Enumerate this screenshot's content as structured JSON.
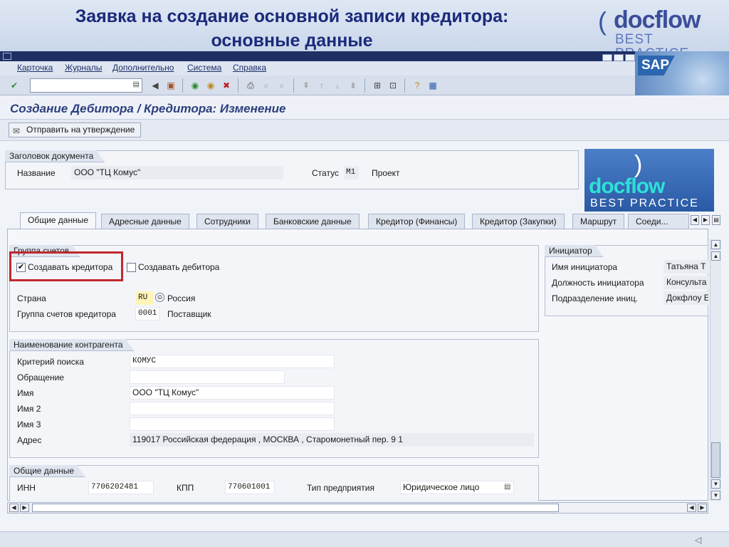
{
  "slide": {
    "title_line1": "Заявка на создание основной записи кредитора:",
    "title_line2": "основные данные",
    "logo_brand": "docflow",
    "logo_tagline": "BEST PRACTICE"
  },
  "menu": [
    "Карточка",
    "Журналы",
    "Дополнительно",
    "Система",
    "Справка"
  ],
  "sap_logo": "SAP",
  "page_title": "Создание Дебитора / Кредитора: Изменение",
  "app_toolbar": {
    "send_label": "Отправить на утверждение"
  },
  "doc_header": {
    "group_title": "Заголовок документа",
    "name_label": "Название",
    "name_value": "ООО \"ТЦ Комус\"",
    "status_label": "Статус",
    "status_code": "M1",
    "status_text": "Проект"
  },
  "tabs": [
    "Общие данные",
    "Адресные данные",
    "Сотрудники",
    "Банковские данные",
    "Кредитор (Финансы)",
    "Кредитор (Закупки)",
    "Маршрут",
    "Соеди..."
  ],
  "accounts_group": {
    "title": "Группа счетов",
    "create_creditor_label": "Создавать кредитора",
    "create_creditor_checked": true,
    "create_debtor_label": "Создавать дебитора",
    "create_debtor_checked": false,
    "country_label": "Страна",
    "country_code": "RU",
    "country_name": "Россия",
    "group_label": "Группа счетов кредитора",
    "group_code": "0001",
    "group_name": "Поставщик"
  },
  "initiator": {
    "title": "Инициатор",
    "rows": [
      {
        "label": "Имя инициатора",
        "value": "Татьяна Т"
      },
      {
        "label": "Должность инициатора",
        "value": "Консульта"
      },
      {
        "label": "Подразделение иниц.",
        "value": "Докфлоу Е"
      }
    ]
  },
  "counterparty": {
    "title": "Наименование контрагента",
    "rows": [
      {
        "label": "Критерий поиска",
        "value": "КОМУС"
      },
      {
        "label": "Обращение",
        "value": ""
      },
      {
        "label": "Имя",
        "value": "ООО \"ТЦ Комус\""
      },
      {
        "label": "Имя 2",
        "value": ""
      },
      {
        "label": "Имя 3",
        "value": ""
      },
      {
        "label": "Адрес",
        "value": "119017 Российская федерация , МОСКВА , Старомонетный пер. 9 1"
      }
    ]
  },
  "general": {
    "title": "Общие данные",
    "inn_label": "ИНН",
    "inn_value": "7706202481",
    "kpp_label": "КПП",
    "kpp_value": "770601001",
    "type_label": "Тип предприятия",
    "type_value": "Юридическое лицо"
  }
}
